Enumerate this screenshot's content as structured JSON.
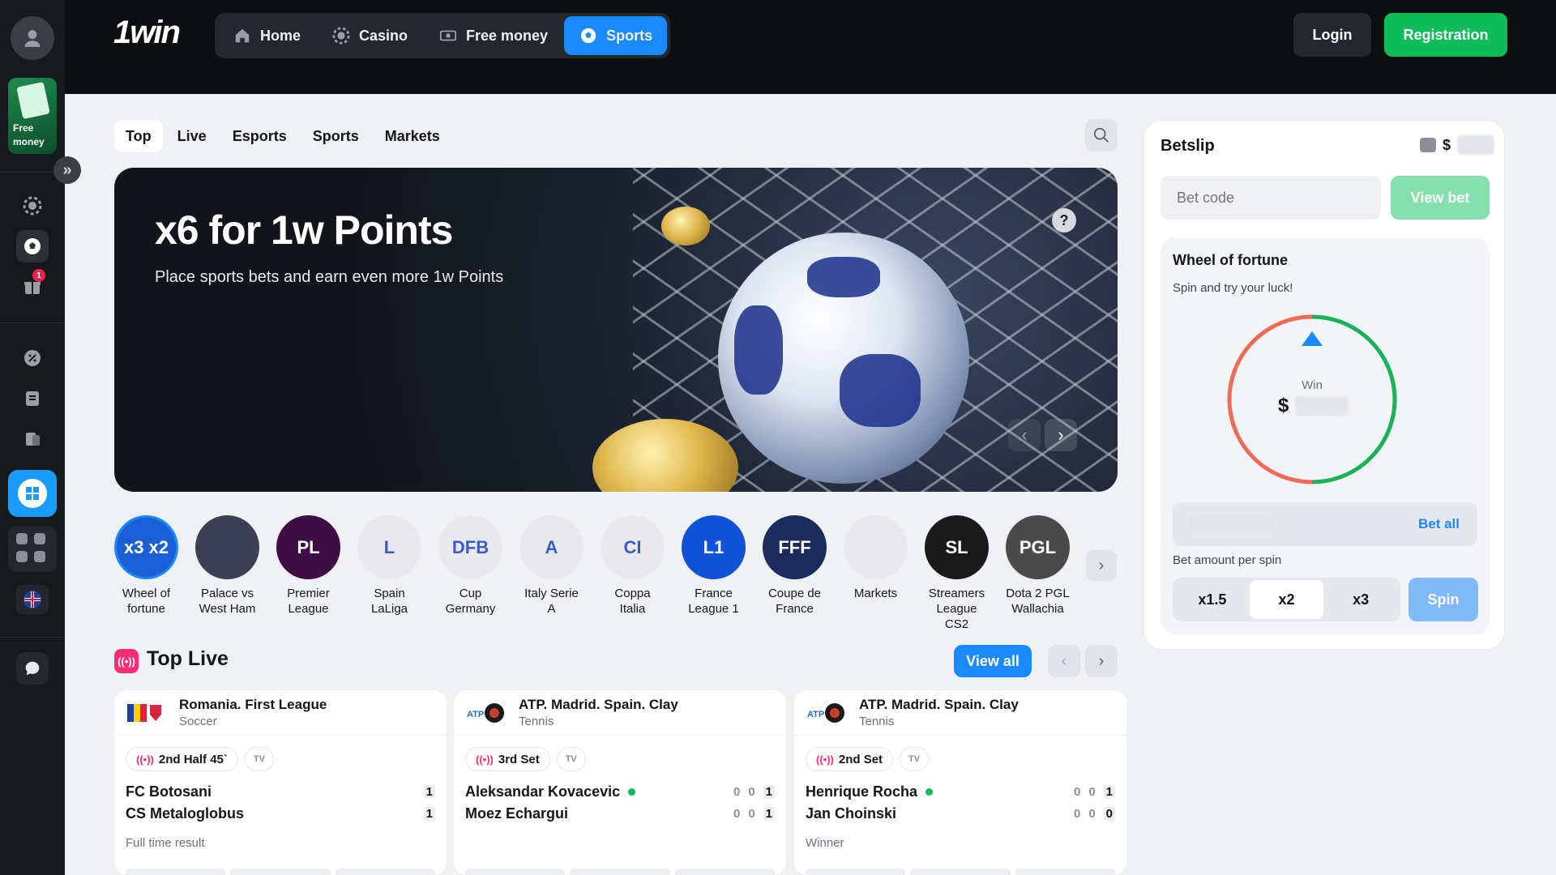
{
  "header": {
    "logo": "1win",
    "nav": [
      {
        "label": "Home",
        "icon": "home-icon"
      },
      {
        "label": "Casino",
        "icon": "casino-chip-icon"
      },
      {
        "label": "Free money",
        "icon": "money-icon"
      },
      {
        "label": "Sports",
        "icon": "soccer-ball-icon",
        "active": true
      }
    ],
    "login": "Login",
    "registration": "Registration"
  },
  "sidebar": {
    "promo_label": "Free money",
    "badge_count": "1"
  },
  "tabs": [
    {
      "label": "Top",
      "active": true
    },
    {
      "label": "Live"
    },
    {
      "label": "Esports"
    },
    {
      "label": "Sports"
    },
    {
      "label": "Markets"
    }
  ],
  "banner": {
    "title": "x6 for 1w Points",
    "subtitle": "Place sports bets and earn even more 1w Points",
    "help": "?"
  },
  "categories": [
    {
      "label": "Wheel of fortune",
      "icon_text": "x3 x2",
      "color": "#1a5fd6"
    },
    {
      "label": "Palace vs West Ham",
      "icon_text": "",
      "color": "#3c3f55"
    },
    {
      "label": "Premier League",
      "icon_text": "PL",
      "color": "#3d0d44"
    },
    {
      "label": "Spain LaLiga",
      "icon_text": "L",
      "color": "#e9e9ec"
    },
    {
      "label": "Cup Germany",
      "icon_text": "DFB",
      "color": "#e9e9ec"
    },
    {
      "label": "Italy Serie A",
      "icon_text": "A",
      "color": "#e9e9ec"
    },
    {
      "label": "Coppa Italia",
      "icon_text": "CI",
      "color": "#e9e9ec"
    },
    {
      "label": "France League 1",
      "icon_text": "L1",
      "color": "#1252d9"
    },
    {
      "label": "Coupe de France",
      "icon_text": "FFF",
      "color": "#1b2b5c"
    },
    {
      "label": "Markets",
      "icon_text": "",
      "color": "#e9e9ec"
    },
    {
      "label": "Streamers League CS2",
      "icon_text": "SL",
      "color": "#1a1a1a"
    },
    {
      "label": "Dota 2 PGL Wallachia",
      "icon_text": "PGL",
      "color": "#4a4a4a"
    }
  ],
  "top_live": {
    "title": "Top Live",
    "view_all": "View all",
    "matches": [
      {
        "league": "Romania. First League",
        "sport": "Soccer",
        "status": "2nd Half 45`",
        "tv": "TV",
        "team1": "FC Botosani",
        "team2": "CS Metaloglobus",
        "score1": [
          "1"
        ],
        "score2": [
          "1"
        ],
        "market": "Full time result"
      },
      {
        "league": "ATP. Madrid. Spain. Clay",
        "sport": "Tennis",
        "status": "3rd Set",
        "tv": "TV",
        "team1": "Aleksandar Kovacevic",
        "team2": "Moez Echargui",
        "score1": [
          "0",
          "0",
          "1"
        ],
        "score2": [
          "0",
          "0",
          "1"
        ],
        "market": ""
      },
      {
        "league": "ATP. Madrid. Spain. Clay",
        "sport": "Tennis",
        "status": "2nd Set",
        "tv": "TV",
        "team1": "Henrique Rocha",
        "team2": "Jan Choinski",
        "score1": [
          "0",
          "0",
          "1"
        ],
        "score2": [
          "0",
          "0",
          "0"
        ],
        "market": "Winner"
      }
    ]
  },
  "betslip": {
    "title": "Betslip",
    "currency": "$",
    "bet_code_placeholder": "Bet code",
    "view_bet": "View bet",
    "wheel": {
      "title": "Wheel of fortune",
      "subtitle": "Spin and try your luck!",
      "win_label": "Win",
      "currency": "$",
      "bet_all": "Bet all",
      "amount_label": "Bet amount per spin",
      "multipliers": [
        "x1.5",
        "x2",
        "x3"
      ],
      "spin": "Spin"
    }
  },
  "colors": {
    "accent_blue": "#1a8bff",
    "accent_green": "#0ebd5a",
    "live_pink": "#ff2e74"
  }
}
